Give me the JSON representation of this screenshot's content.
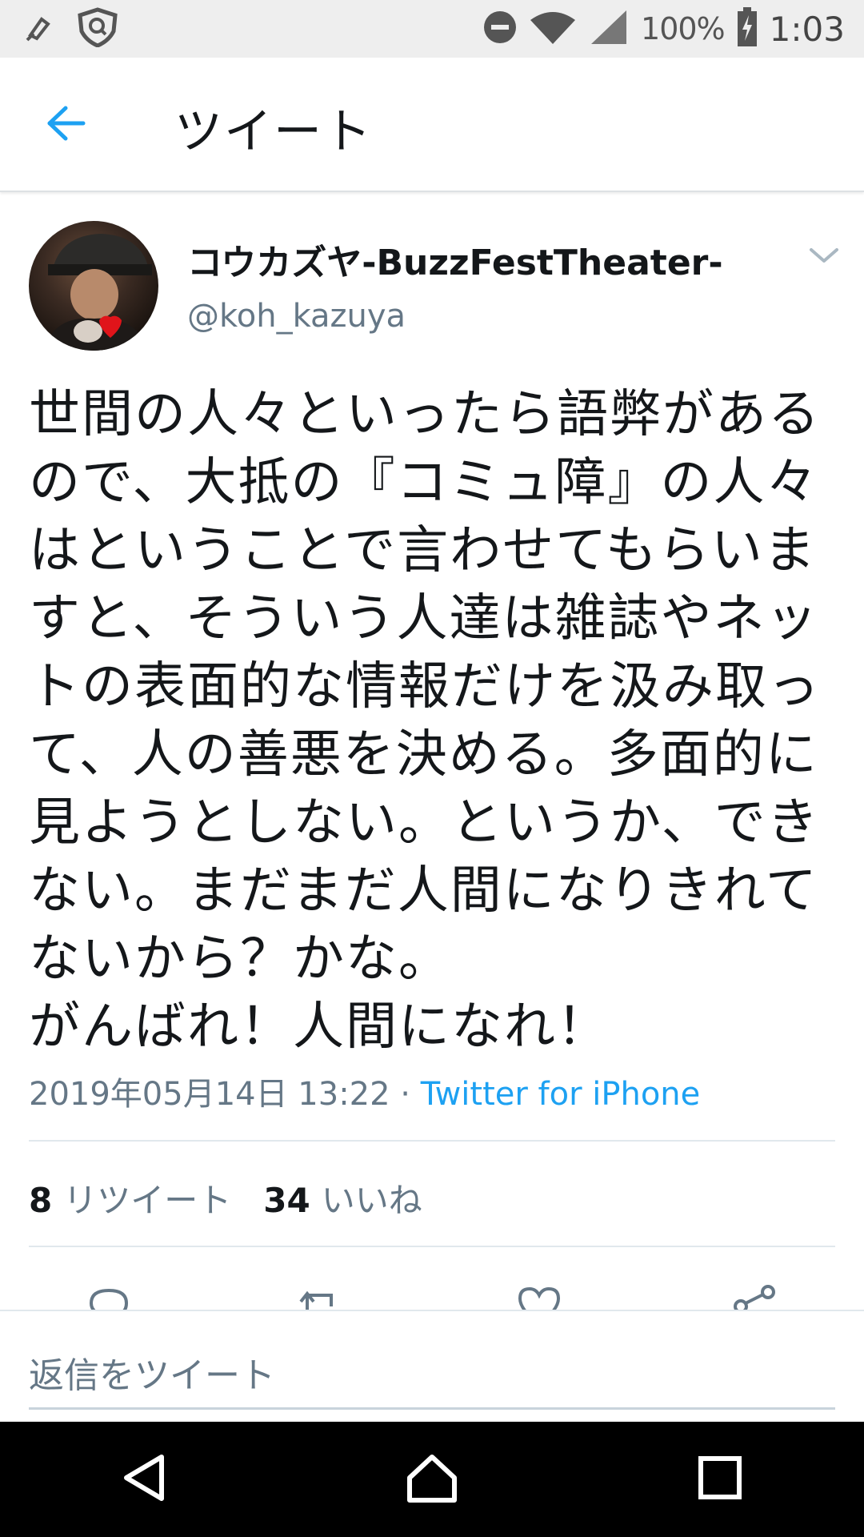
{
  "status_bar": {
    "battery": "100%",
    "time": "1:03",
    "icons": [
      "notification-icon",
      "vpn-shield-icon",
      "do-not-disturb-icon",
      "wifi-icon",
      "signal-icon",
      "battery-charging-icon"
    ]
  },
  "header": {
    "title": "ツイート",
    "back_icon": "back-arrow-icon"
  },
  "tweet": {
    "display_name": "コウカズヤ-BuzzFestTheater-",
    "handle": "@koh_kazuya",
    "text": "世間の人々といったら語弊があるので、大抵の『コミュ障』の人々はということで言わせてもらいますと、そういう人達は雑誌やネットの表面的な情報だけを汲み取って、人の善悪を決める。多面的に見ようとしない。というか、できない。まだまだ人間になりきれてないから？かな。\nがんばれ！人間になれ！",
    "timestamp": "2019年05月14日 13:22",
    "separator": " · ",
    "source": "Twitter for iPhone",
    "retweet_count": "8",
    "retweet_label": "リツイート",
    "like_count": "34",
    "like_label": "いいね"
  },
  "actions": [
    "reply-icon",
    "retweet-icon",
    "like-icon",
    "share-icon"
  ],
  "reply": {
    "placeholder": "返信をツイート"
  },
  "nav": [
    "back-nav-icon",
    "home-nav-icon",
    "recents-nav-icon"
  ],
  "colors": {
    "accent": "#1da1f2",
    "secondary_text": "#657786",
    "primary_text": "#14171a"
  }
}
